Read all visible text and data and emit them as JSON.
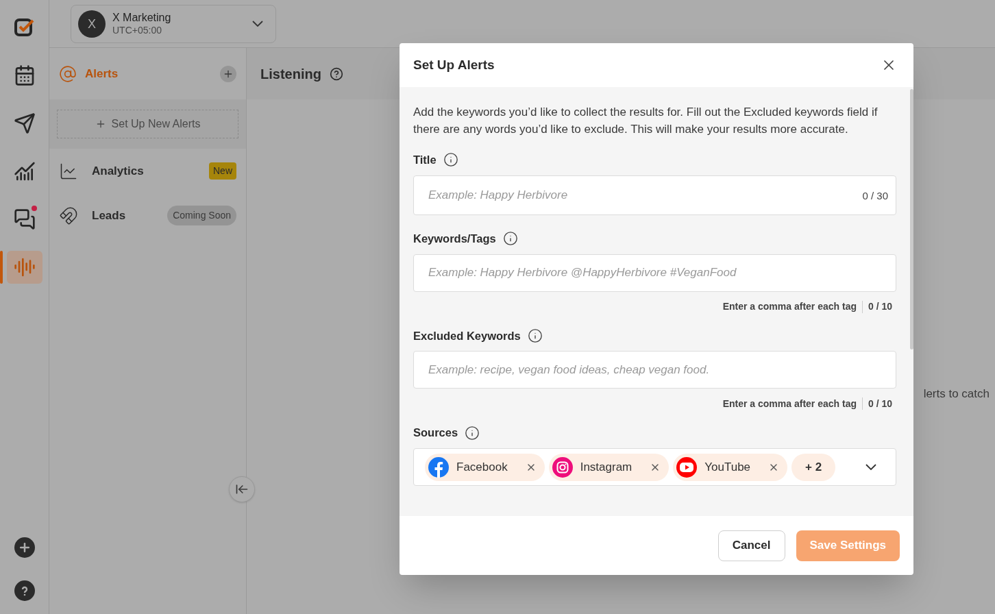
{
  "rail": {
    "items": [
      {
        "kind": "logo",
        "selected": false,
        "notification": false
      },
      {
        "kind": "calendar",
        "selected": false,
        "notification": false
      },
      {
        "kind": "send",
        "selected": false,
        "notification": false
      },
      {
        "kind": "chart",
        "selected": false,
        "notification": false
      },
      {
        "kind": "chat",
        "selected": false,
        "notification": true
      },
      {
        "kind": "listening",
        "selected": true,
        "notification": false
      }
    ],
    "bottom": [
      {
        "kind": "add"
      },
      {
        "kind": "help"
      }
    ]
  },
  "account": {
    "initial": "X",
    "name": "X Marketing",
    "timezone": "UTC+05:00"
  },
  "sidebar": {
    "section": {
      "label": "Alerts",
      "selected": true
    },
    "new_alert_button": "Set Up New Alerts",
    "items": [
      {
        "label": "Analytics",
        "kind": "analytics",
        "badge": "New",
        "highlighted": true
      },
      {
        "label": "Leads",
        "kind": "leads",
        "badge": "Coming Soon",
        "highlighted": false
      }
    ]
  },
  "page": {
    "title": "Listening",
    "hint_fragment": "lerts to catch"
  },
  "modal": {
    "title": "Set Up Alerts",
    "intro": "Add the keywords you’d like to collect the results for. Fill out the Excluded keywords field if there are any words you’d like to exclude. This will make your results more accurate.",
    "fields": [
      {
        "label": "Title",
        "placeholder": "Example: Happy Herbivore",
        "counter": "0 / 30"
      },
      {
        "label": "Keywords/Tags",
        "placeholder": "Example: Happy Herbivore @HappyHerbivore #VeganFood",
        "helper": "Enter a comma after each tag",
        "counter": "0 / 10"
      },
      {
        "label": "Excluded Keywords",
        "placeholder": "Example: recipe, vegan food ideas, cheap vegan food.",
        "helper": "Enter a comma after each tag",
        "counter": "0 / 10"
      }
    ],
    "sources": {
      "label": "Sources",
      "chips": [
        {
          "name": "Facebook",
          "kind": "facebook"
        },
        {
          "name": "Instagram",
          "kind": "instagram"
        },
        {
          "name": "YouTube",
          "kind": "youtube"
        }
      ],
      "more": "+ 2"
    },
    "cancel": "Cancel",
    "save": {
      "label": "Save Settings",
      "disabled": true
    }
  }
}
